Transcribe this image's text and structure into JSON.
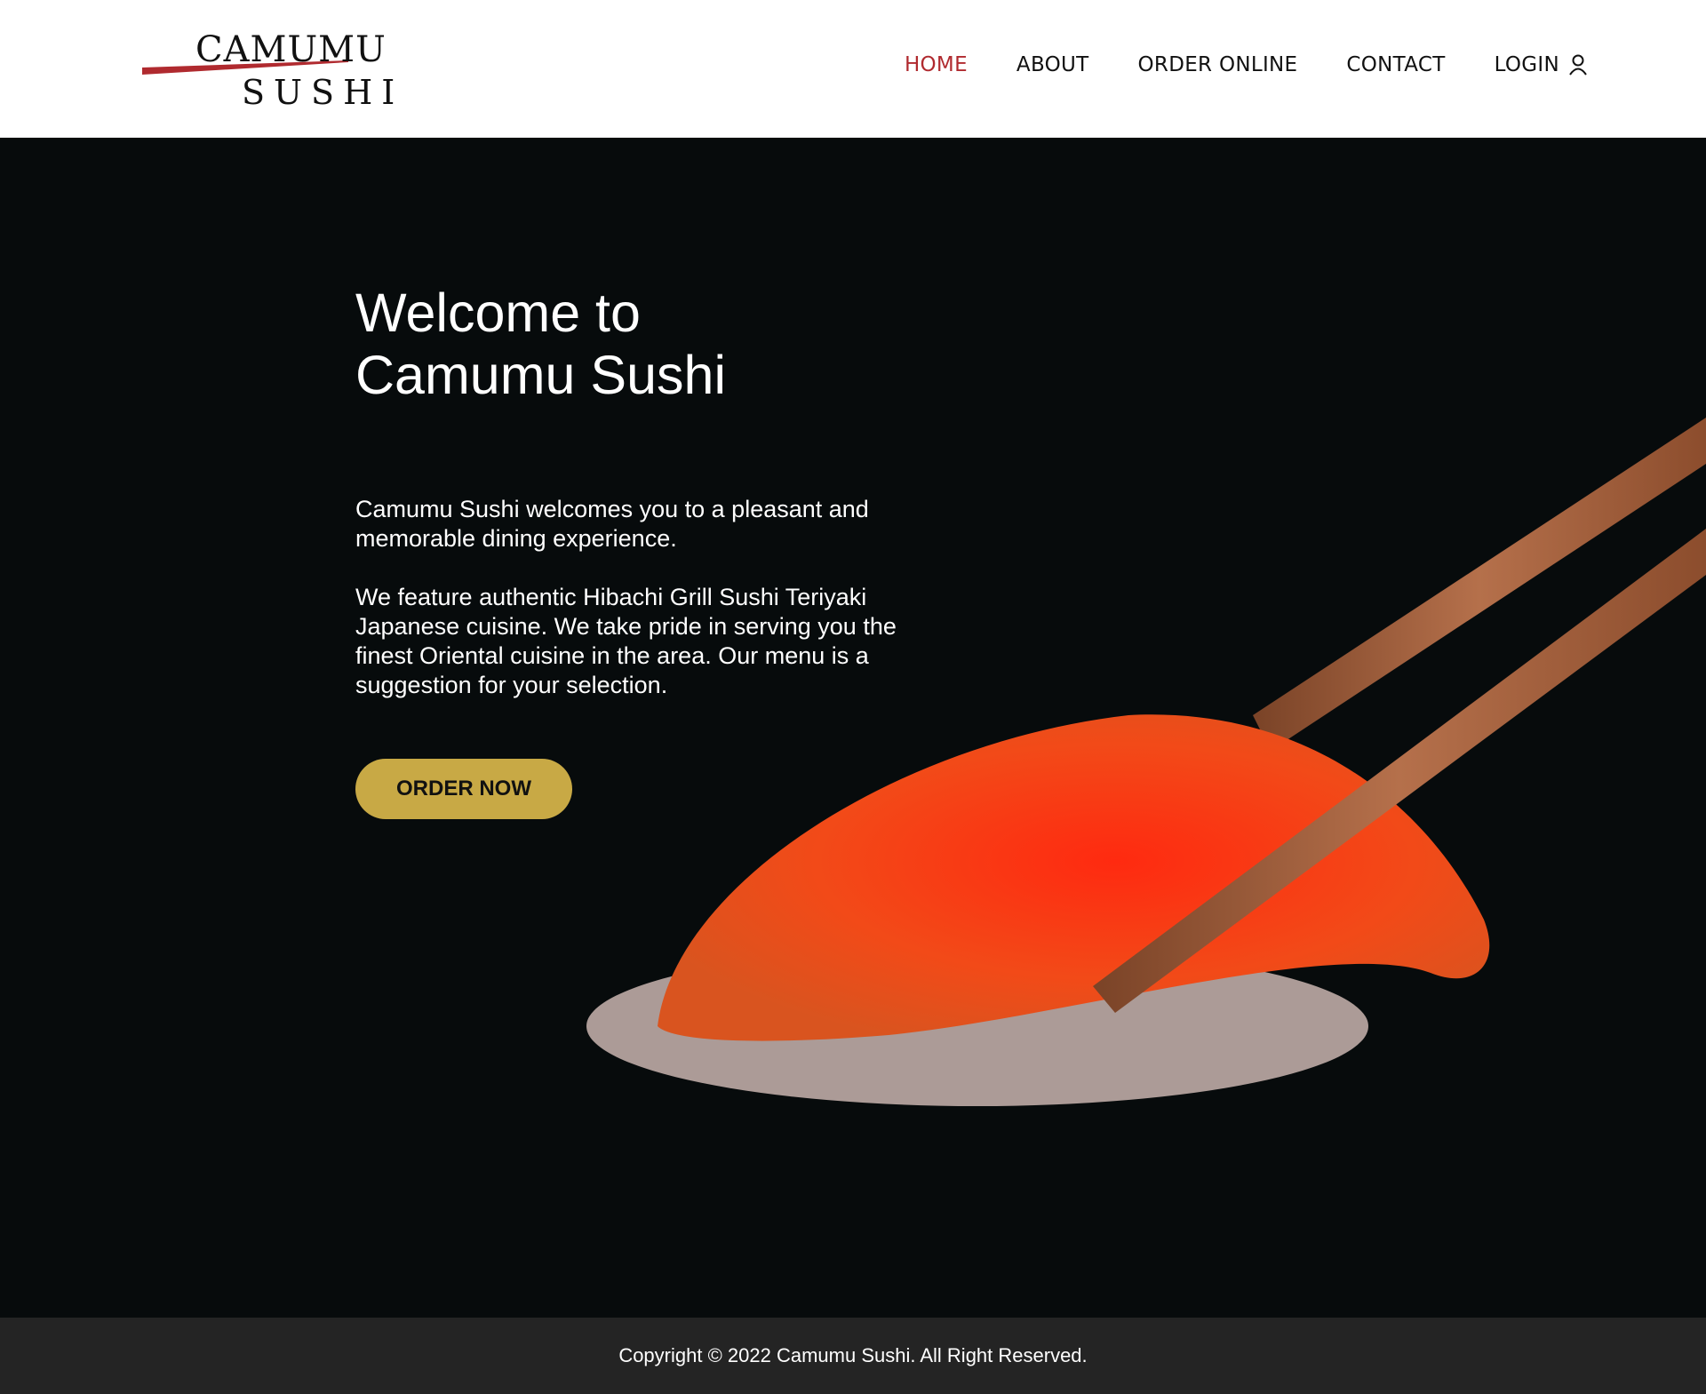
{
  "brand": {
    "line1": "CAMUMU",
    "line2": "SUSHI",
    "accent": "#b02a2f"
  },
  "nav": {
    "items": [
      "HOME",
      "ABOUT",
      "ORDER ONLINE",
      "CONTACT"
    ],
    "active": "HOME",
    "login_label": "LOGIN",
    "login_icon": "user-icon"
  },
  "hero": {
    "title_line1": "Welcome to",
    "title_line2": "Camumu Sushi",
    "paragraph1": "Camumu Sushi welcomes you to a pleasant and memorable dining experience.",
    "paragraph2": "We feature authentic Hibachi Grill Sushi Teriyaki Japanese cuisine. We take pride in serving you the finest Oriental cuisine in the area. Our menu is a suggestion for your selection.",
    "cta_label": "ORDER NOW",
    "cta_color": "#c8a945",
    "background": "#070b0c"
  },
  "footer": {
    "copyright": "Copyright © 2022 Camumu Sushi. All Right Reserved."
  }
}
